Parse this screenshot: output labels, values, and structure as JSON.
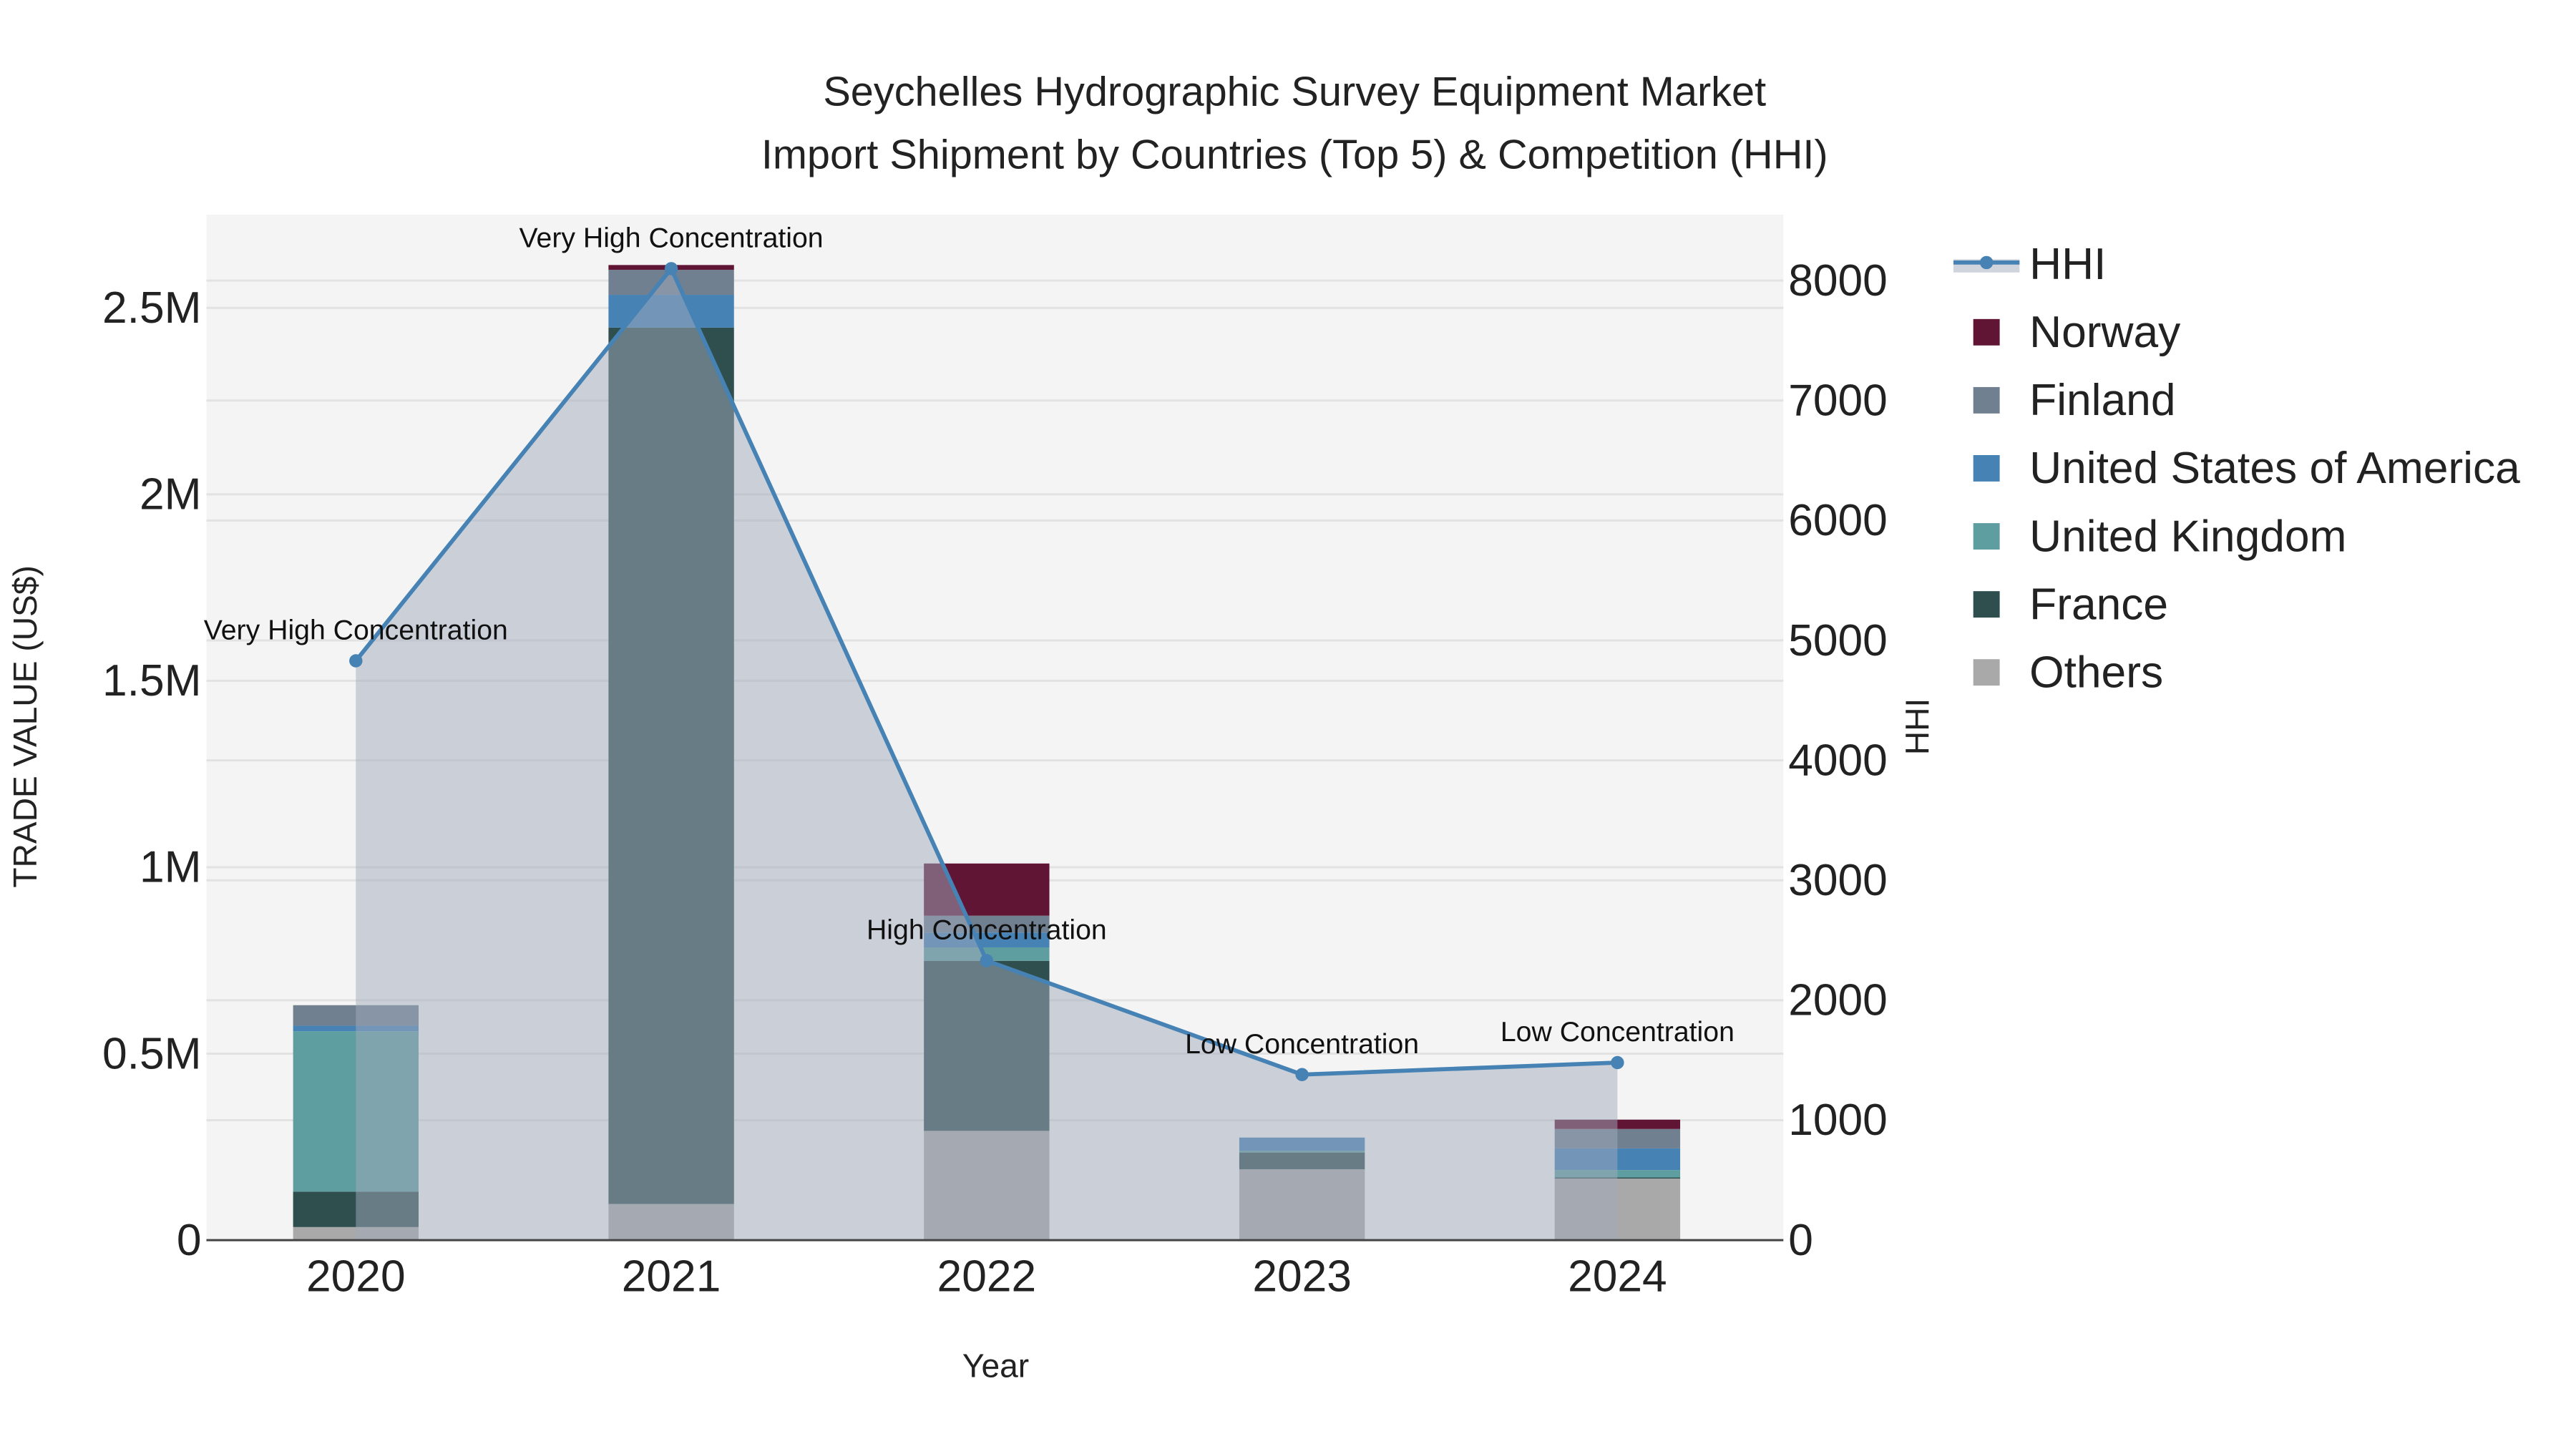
{
  "chart_data": {
    "type": "bar",
    "title_line1": "Seychelles Hydrographic Survey Equipment Market",
    "title_line2": "Import Shipment by Countries (Top 5) & Competition (HHI)",
    "xlabel": "Year",
    "ylabel": "TRADE VALUE (US$)",
    "y2label": "HHI",
    "categories": [
      "2020",
      "2021",
      "2022",
      "2023",
      "2024"
    ],
    "ylim": [
      0,
      2750000
    ],
    "y2lim": [
      0,
      8550
    ],
    "yticks": [
      {
        "v": 0,
        "label": "0"
      },
      {
        "v": 500000,
        "label": "0.5M"
      },
      {
        "v": 1000000,
        "label": "1M"
      },
      {
        "v": 1500000,
        "label": "1.5M"
      },
      {
        "v": 2000000,
        "label": "2M"
      },
      {
        "v": 2500000,
        "label": "2.5M"
      }
    ],
    "y2ticks": [
      0,
      1000,
      2000,
      3000,
      4000,
      5000,
      6000,
      7000,
      8000
    ],
    "series": [
      {
        "name": "Others",
        "color": "#A9A9A9",
        "values": [
          35000,
          97000,
          293000,
          190000,
          165000
        ]
      },
      {
        "name": "France",
        "color": "#2F4F4F",
        "values": [
          95000,
          2350000,
          456000,
          45000,
          3000
        ]
      },
      {
        "name": "United Kingdom",
        "color": "#5F9EA0",
        "values": [
          430000,
          0,
          36000,
          5000,
          20000
        ]
      },
      {
        "name": "United States of America",
        "color": "#4682B4",
        "values": [
          15000,
          88000,
          40000,
          35000,
          58000
        ]
      },
      {
        "name": "Finland",
        "color": "#708090",
        "values": [
          55000,
          67000,
          45000,
          0,
          52000
        ]
      },
      {
        "name": "Norway",
        "color": "#611535",
        "values": [
          0,
          13000,
          140000,
          0,
          25000
        ]
      }
    ],
    "hhi": {
      "name": "HHI",
      "color": "#4682B4",
      "values": [
        4830,
        8100,
        2330,
        1380,
        1480
      ],
      "annotations": [
        "Very High Concentration",
        "Very High Concentration",
        "High Concentration",
        "Low Concentration",
        "Low Concentration"
      ]
    },
    "legend": {
      "placement": "right",
      "order": [
        "HHI",
        "Norway",
        "Finland",
        "United States of America",
        "United Kingdom",
        "France",
        "Others"
      ]
    },
    "grid": true
  }
}
